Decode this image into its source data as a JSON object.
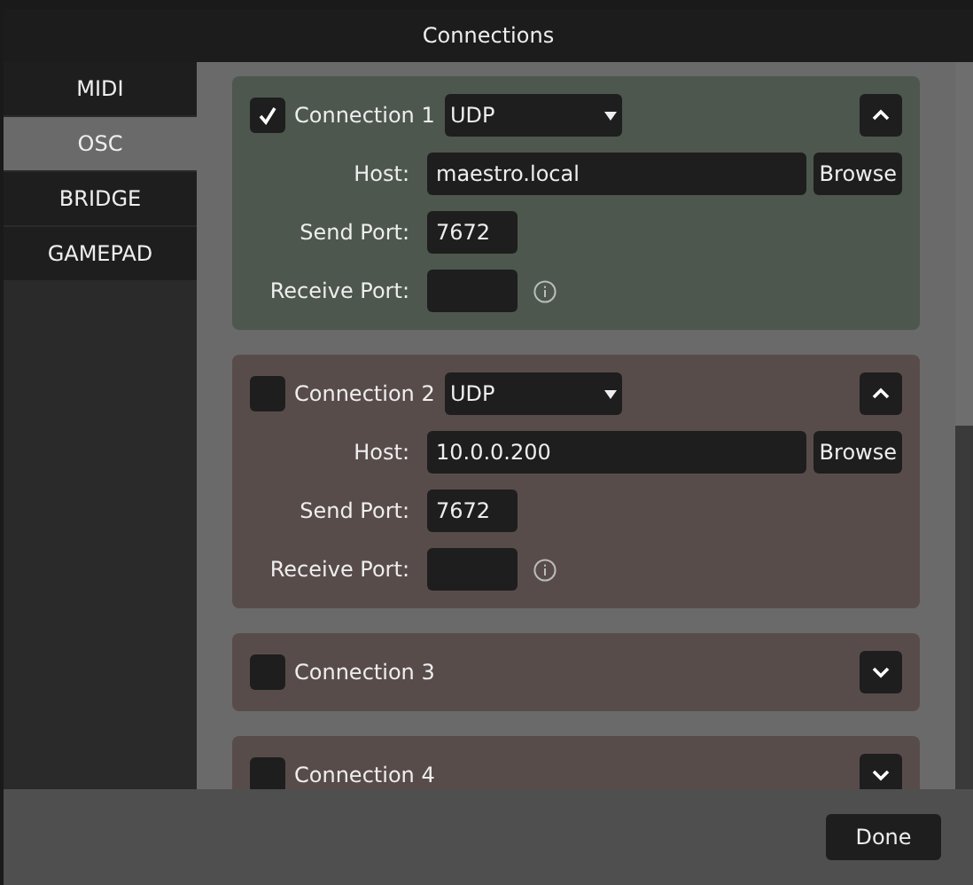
{
  "window": {
    "title": "Connections"
  },
  "tabs": [
    {
      "label": "MIDI",
      "selected": false
    },
    {
      "label": "OSC",
      "selected": true
    },
    {
      "label": "BRIDGE",
      "selected": false
    },
    {
      "label": "GAMEPAD",
      "selected": false
    }
  ],
  "connections": [
    {
      "name": "Connection 1",
      "checked": true,
      "expanded": true,
      "protocol": "UDP",
      "host_label": "Host:",
      "host": "maestro.local",
      "browse": "Browse",
      "send_port_label": "Send Port:",
      "send_port": "7672",
      "receive_port_label": "Receive Port:"
    },
    {
      "name": "Connection 2",
      "checked": false,
      "expanded": true,
      "protocol": "UDP",
      "host_label": "Host:",
      "host": "10.0.0.200",
      "browse": "Browse",
      "send_port_label": "Send Port:",
      "send_port": "7672",
      "receive_port_label": "Receive Port:"
    },
    {
      "name": "Connection 3",
      "checked": false,
      "expanded": false
    },
    {
      "name": "Connection 4",
      "checked": false,
      "expanded": false
    }
  ],
  "done_button": "Done"
}
